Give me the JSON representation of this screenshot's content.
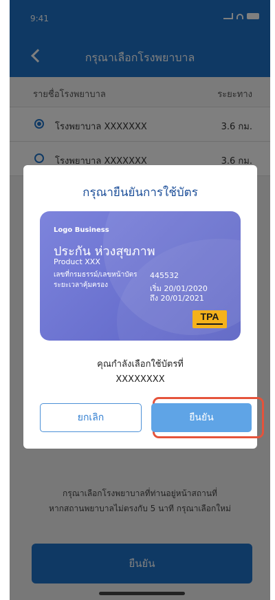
{
  "status_bar": {
    "time": "9:41"
  },
  "header": {
    "title": "กรุณาเลือกโรงพยาบาล"
  },
  "list": {
    "col_left": "รายชื่อโรงพยาบาล",
    "col_right": "ระยะทาง",
    "rows": [
      {
        "name": "โรงพยาบาล XXXXXXX",
        "dist": "3.6 กม."
      },
      {
        "name": "โรงพยาบาล XXXXXXX",
        "dist": "3.6 กม."
      }
    ]
  },
  "footer": {
    "note_line1": "กรุณาเลือกโรงพยาบาลที่ท่านอยู่หน้าสถานที่",
    "note_line2": "หากสถานพยาบาลไม่ตรงกับ 5 นาที กรุณาเลือกใหม่",
    "next_label": "ยืนยัน"
  },
  "modal": {
    "title": "กรุณายืนยันการใช้บัตร",
    "card": {
      "logo": "Logo Business",
      "insurance_name": "ประกัน ห่วงสุขภาพ",
      "product": "Product XXX",
      "policy_label": "เลขที่กรมธรรม์/เลขหน้าบัตร",
      "policy_value": "445532",
      "coverage_label": "ระยะเวลาคุ้มครอง",
      "coverage_start": "เริ่ม 20/01/2020",
      "coverage_end": "ถึง 20/01/2021",
      "tpa": "TPA"
    },
    "message_line1": "คุณกำลังเลือกใช้บัตรที่",
    "message_line2": "XXXXXXXX",
    "cancel_label": "ยกเลิก",
    "confirm_label": "ยืนยัน"
  },
  "colors": {
    "primary": "#1f73c9",
    "card": "#6a71cf",
    "confirm": "#5fa4e6",
    "highlight": "#e5533b",
    "tpa": "#f5b21b"
  }
}
